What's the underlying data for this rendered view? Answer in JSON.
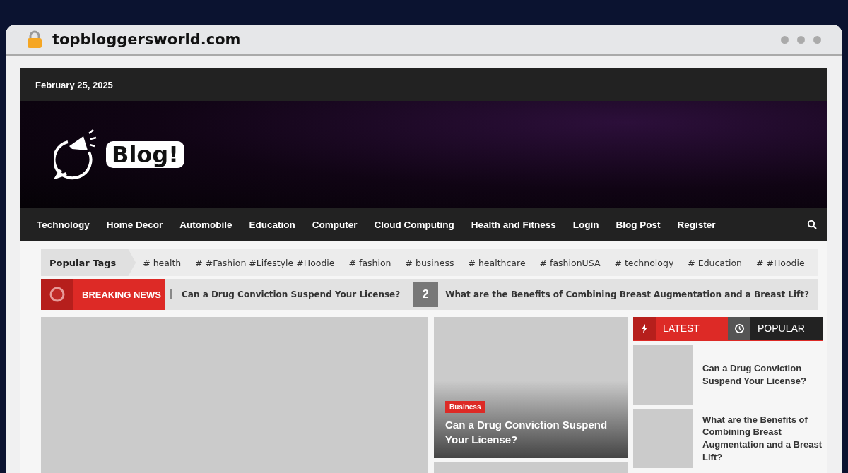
{
  "browser": {
    "url": "topbloggersworld.com"
  },
  "top_bar": {
    "date": "February 25, 2025"
  },
  "header": {
    "logo_text": "Blog!"
  },
  "nav": {
    "items": [
      "Technology",
      "Home Decor",
      "Automobile",
      "Education",
      "Computer",
      "Cloud Computing",
      "Health and Fitness",
      "Login",
      "Blog Post",
      "Register"
    ]
  },
  "tags": {
    "label": "Popular Tags",
    "items": [
      "# health",
      "# #Fashion #Lifestyle #Hoodie",
      "# fashion",
      "# business",
      "# healthcare",
      "# fashionUSA",
      "# technology",
      "# Education",
      "# #Hoodie"
    ]
  },
  "breaking": {
    "label": "BREAKING NEWS",
    "items": [
      {
        "title": "Can a Drug Conviction Suspend Your License?"
      },
      {
        "number": "2",
        "title": "What are the Benefits of Combining Breast Augmentation and a Breast Lift?"
      }
    ]
  },
  "featured": {
    "category": "Business",
    "title": "Can a Drug Conviction Suspend Your License?"
  },
  "sidebar": {
    "tabs": [
      {
        "label": "LATEST",
        "kind": "latest",
        "selected": true
      },
      {
        "label": "POPULAR",
        "kind": "popular",
        "selected": false
      }
    ],
    "posts": [
      "Can a Drug Conviction Suspend Your License?",
      "What are the Benefits of Combining Breast Augmentation and a Breast Lift?"
    ]
  }
}
